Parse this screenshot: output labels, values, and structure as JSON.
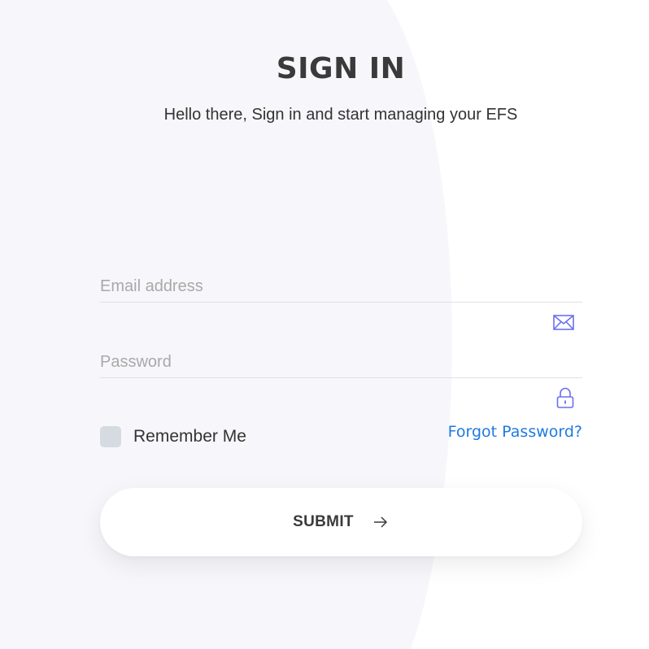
{
  "header": {
    "title": "SIGN IN",
    "subtitle": "Hello there, Sign in and start managing your EFS"
  },
  "form": {
    "email": {
      "placeholder": "Email address",
      "value": "",
      "icon": "envelope-icon"
    },
    "password": {
      "placeholder": "Password",
      "value": "",
      "icon": "lock-icon"
    },
    "remember_label": "Remember Me",
    "remember_checked": false,
    "forgot_label": "Forgot Password?",
    "submit_label": "SUBMIT",
    "submit_icon": "arrow-right-icon"
  },
  "colors": {
    "accent": "#1f7ae0",
    "icon": "#6b6ff0",
    "background_panel": "#f7f7fb"
  }
}
